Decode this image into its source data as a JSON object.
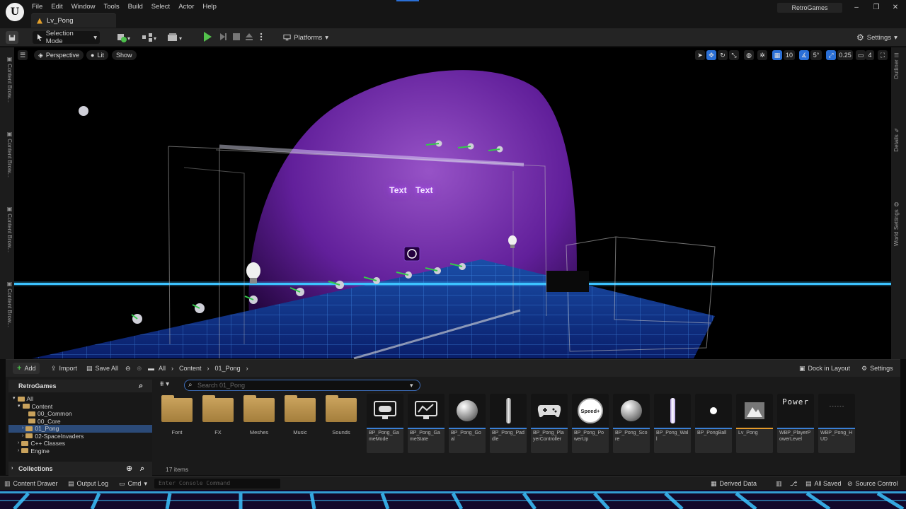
{
  "menu": [
    "File",
    "Edit",
    "Window",
    "Tools",
    "Build",
    "Select",
    "Actor",
    "Help"
  ],
  "level_tab": "Lv_Pong",
  "project_name": "RetroGames",
  "toolbar": {
    "selection_mode": "Selection Mode",
    "platforms": "Platforms",
    "settings": "Settings"
  },
  "left_tabs": [
    "Content Brow...",
    "Content Brow...",
    "Content Brow...",
    "Content Brow..."
  ],
  "right_tabs": [
    "Outliner",
    "Details",
    "World Settings"
  ],
  "viewport": {
    "perspective": "Perspective",
    "lit": "Lit",
    "show": "Show",
    "grid_size": "10",
    "rotation_snap": "5°",
    "scale_snap": "0.25",
    "camera_speed": "4",
    "text_actor_1": "Text",
    "text_actor_2": "Text"
  },
  "content_browser": {
    "add": "Add",
    "import": "Import",
    "save_all": "Save All",
    "breadcrumb": [
      "All",
      "Content",
      "01_Pong"
    ],
    "dock_in_layout": "Dock in Layout",
    "settings": "Settings",
    "search_placeholder": "Search 01_Pong",
    "tree_root": "RetroGames",
    "tree": [
      {
        "label": "All",
        "indent": 0
      },
      {
        "label": "Content",
        "indent": 1
      },
      {
        "label": "00_Common",
        "indent": 2
      },
      {
        "label": "00_Core",
        "indent": 2
      },
      {
        "label": "01_Pong",
        "indent": 2,
        "selected": true
      },
      {
        "label": "02-SpaceInvaders",
        "indent": 2
      },
      {
        "label": "C++ Classes",
        "indent": 1
      },
      {
        "label": "Engine",
        "indent": 1
      }
    ],
    "collections": "Collections",
    "folders": [
      "Font",
      "FX",
      "Meshes",
      "Music",
      "Sounds"
    ],
    "assets": [
      {
        "label": "BP_Pong_GameMode",
        "icon": "gamepad-monitor-icon"
      },
      {
        "label": "BP_Pong_GameState",
        "icon": "chart-monitor-icon"
      },
      {
        "label": "BP_Pong_Goal",
        "icon": "sphere-icon"
      },
      {
        "label": "BP_Pong_Paddle",
        "icon": "paddle-icon"
      },
      {
        "label": "BP_Pong_PlayerController",
        "icon": "controller-icon"
      },
      {
        "label": "BP_Pong_PowerUp",
        "icon": "speed-badge-icon",
        "badge": "Speed+"
      },
      {
        "label": "BP_Pong_Score",
        "icon": "sphere-icon"
      },
      {
        "label": "BP_Pong_Wall",
        "icon": "wall-icon"
      },
      {
        "label": "BP_PongBall",
        "icon": "ball-icon"
      },
      {
        "label": "Lv_Pong",
        "icon": "level-icon"
      },
      {
        "label": "WBP_PlayerPowerLevel",
        "icon": "widget-icon",
        "preview": "Power"
      },
      {
        "label": "WBP_Pong_HUD",
        "icon": "widget-icon",
        "preview": "------"
      }
    ],
    "item_count": "17 items"
  },
  "statusbar": {
    "content_drawer": "Content Drawer",
    "output_log": "Output Log",
    "cmd": "Cmd",
    "console_placeholder": "Enter Console Command",
    "derived_data": "Derived Data",
    "all_saved": "All Saved",
    "source_control": "Source Control"
  }
}
